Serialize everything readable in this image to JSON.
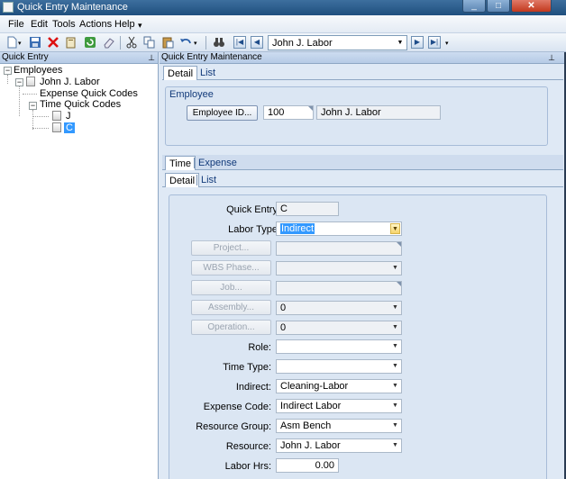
{
  "window": {
    "title": "Quick Entry Maintenance"
  },
  "menu": {
    "items": [
      "File",
      "Edit",
      "Tools",
      "Actions",
      "Help"
    ]
  },
  "toolbar": {
    "nav_value": "John J. Labor"
  },
  "left_panel": {
    "title": "Quick Entry",
    "tree": {
      "root": "Employees",
      "employee": "John J. Labor",
      "expense": "Expense Quick Codes",
      "time": "Time Quick Codes",
      "codes": [
        "J",
        "C"
      ]
    }
  },
  "right_panel": {
    "title": "Quick Entry Maintenance",
    "top_tabs": [
      "Detail",
      "List"
    ],
    "employee_group": {
      "title": "Employee",
      "button": "Employee ID...",
      "id_value": "100",
      "name_value": "John J. Labor"
    },
    "section_tabs": [
      "Time",
      "Expense"
    ],
    "sub_tabs": [
      "Detail",
      "List"
    ],
    "form": {
      "quick_entry_label": "Quick Entry:",
      "quick_entry_value": "C",
      "labor_type_label": "Labor Type:",
      "labor_type_value": "Indirect",
      "project_button": "Project...",
      "wbs_button": "WBS Phase...",
      "job_button": "Job...",
      "assembly_button": "Assembly...",
      "assembly_value": "0",
      "operation_button": "Operation...",
      "operation_value": "0",
      "role_label": "Role:",
      "time_type_label": "Time Type:",
      "indirect_label": "Indirect:",
      "indirect_value": "Cleaning-Labor",
      "expense_code_label": "Expense Code:",
      "expense_code_value": "Indirect Labor",
      "resource_group_label": "Resource Group:",
      "resource_group_value": "Asm Bench",
      "resource_label": "Resource:",
      "resource_value": "John J. Labor",
      "labor_hrs_label": "Labor Hrs:",
      "labor_hrs_value": "0.00"
    }
  }
}
